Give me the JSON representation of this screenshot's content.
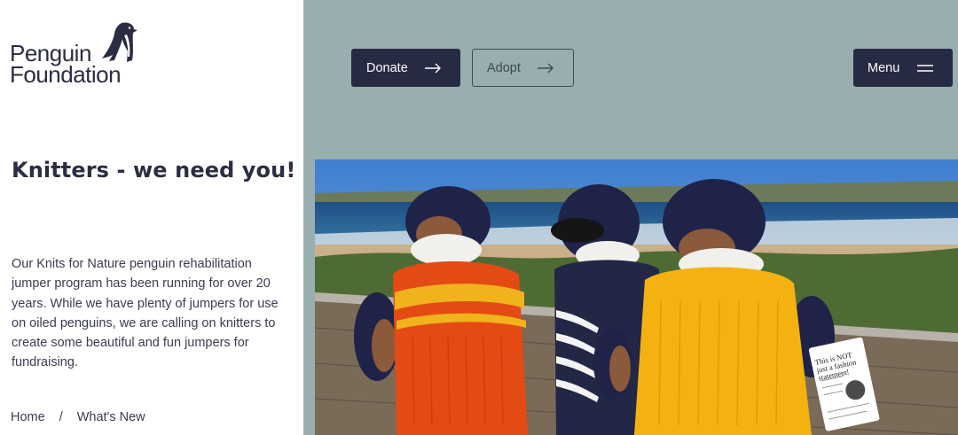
{
  "brand": {
    "line1": "Penguin",
    "line2": "Foundation"
  },
  "headline": "Knitters - we need you!",
  "intro": "Our Knits for Nature penguin rehabilitation jumper program has been running for over 20 years. While we have plenty of jumpers for use on oiled penguins, we are calling on knitters to create some beautiful and fun jumpers for fundraising.",
  "breadcrumb": {
    "home": "Home",
    "separator": "/",
    "current": "What's New"
  },
  "nav": {
    "donate": "Donate",
    "adopt": "Adopt",
    "menu": "Menu"
  },
  "photo": {
    "card_text": "This is NOT just a fashion statement!"
  },
  "colors": {
    "navy": "#272a43",
    "panel": "#99aeae",
    "text": "#2b2d42"
  }
}
